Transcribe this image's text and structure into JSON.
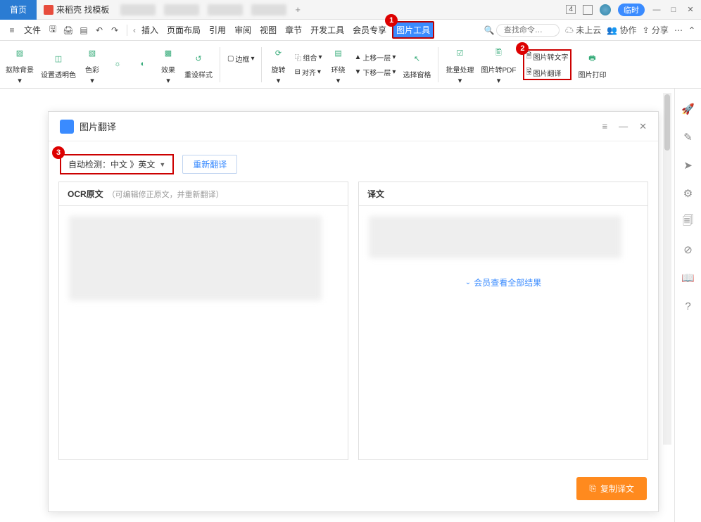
{
  "titlebar": {
    "home": "首页",
    "template": "来稻壳 找模板",
    "grid_num": "4",
    "temp_badge": "临时"
  },
  "menubar": {
    "file": "文件",
    "items": [
      "插入",
      "页面布局",
      "引用",
      "审阅",
      "视图",
      "章节",
      "开发工具",
      "会员专享",
      "图片工具"
    ],
    "search_placeholder": "查找命令…",
    "cloud": "未上云",
    "collab": "协作",
    "share": "分享"
  },
  "ribbon": {
    "remove_bg": "抠除背景",
    "transparent": "设置透明色",
    "color": "色彩",
    "effect": "效果",
    "reset": "重设样式",
    "border": "边框",
    "rotate": "旋转",
    "group": "组合",
    "align": "对齐",
    "wrap": "环绕",
    "up_layer": "上移一层",
    "down_layer": "下移一层",
    "select_pane": "选择窗格",
    "batch": "批量处理",
    "to_pdf": "图片转PDF",
    "to_text": "图片转文字",
    "translate": "图片翻译",
    "print": "图片打印"
  },
  "panel": {
    "title": "图片翻译",
    "lang_label": "自动检测：中文 》英文",
    "retranslate": "重新翻译",
    "ocr_title": "OCR原文",
    "ocr_hint": "（可编辑修正原文，并重新翻译）",
    "trans_title": "译文",
    "member_link": "会员查看全部结果",
    "copy_btn": "复制译文"
  },
  "callouts": {
    "c1": "1",
    "c2": "2",
    "c3": "3"
  }
}
